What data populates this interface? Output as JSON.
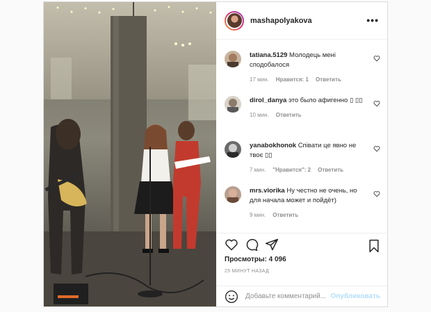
{
  "post": {
    "username": "mashapolyakova",
    "more_label": "•••",
    "views": "Просмотры: 4 096",
    "time_ago": "25 МИНУТ НАЗАД",
    "add_comment_placeholder": "Добавьте комментарий...",
    "publish_label": "Опубликовать"
  },
  "comments": [
    {
      "user": "tatiana.5129",
      "text": "Молодець мені сподобалося",
      "time": "17 мин.",
      "likes": "Нравится: 1",
      "reply": "Ответить"
    },
    {
      "user": "dirol_danya",
      "text": "это было афигенно ▯ ▯▯",
      "time": "10 мин.",
      "likes": "",
      "reply": "Ответить"
    },
    {
      "user": "yanabokhonok",
      "text": "Співати це явно не твоє ▯▯",
      "time": "7 мин.",
      "likes": "\"Нравится\": 2",
      "reply": "Ответить"
    },
    {
      "user": "mrs.viorika",
      "text": "Ну честно не очень, но для начала может и пойдёт)",
      "time": "9 мин.",
      "likes": "",
      "reply": "Ответить"
    }
  ],
  "icons": {
    "like": "heart-icon",
    "comment": "comment-icon",
    "share": "share-icon",
    "save": "bookmark-icon",
    "emoji": "emoji-icon",
    "more": "more-icon"
  }
}
